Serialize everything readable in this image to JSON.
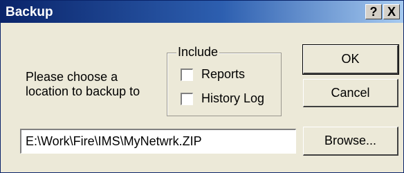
{
  "window": {
    "title": "Backup",
    "help_button": "?",
    "close_button": "X"
  },
  "prompt": {
    "line1": "Please choose a",
    "line2": "location to backup to"
  },
  "include_group": {
    "legend": "Include",
    "options": [
      {
        "label": "Reports",
        "checked": false
      },
      {
        "label": "History Log",
        "checked": false
      }
    ]
  },
  "buttons": {
    "ok": "OK",
    "cancel": "Cancel",
    "browse": "Browse..."
  },
  "path_input": {
    "value": "E:\\Work\\Fire\\IMS\\MyNetwrk.ZIP"
  },
  "colors": {
    "titlebar_start": "#0a246a",
    "titlebar_end": "#a6caf0",
    "dialog_bg": "#ece9d8"
  }
}
